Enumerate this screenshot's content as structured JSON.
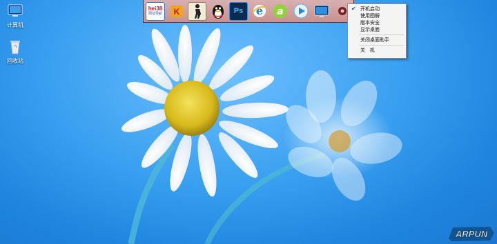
{
  "desktop": {
    "icons": [
      {
        "label": "计算机",
        "icon": "computer-icon"
      },
      {
        "label": "回收站",
        "icon": "recycle-bin-icon"
      }
    ]
  },
  "toolbar": {
    "apps": [
      {
        "name": "hei38-nav",
        "text_top": "hei38",
        "text_bottom": "网址导航"
      },
      {
        "name": "kugou",
        "icon": "kugou-icon"
      },
      {
        "name": "cs-game",
        "icon": "counter-strike-icon"
      },
      {
        "name": "qq",
        "icon": "qq-penguin-icon"
      },
      {
        "name": "photoshop",
        "text": "Ps"
      },
      {
        "name": "ie-browser",
        "icon": "ie-icon"
      },
      {
        "name": "aiqiyi",
        "icon": "green-a-icon"
      },
      {
        "name": "media-player",
        "icon": "play-icon"
      },
      {
        "name": "show-desktop",
        "icon": "monitor-icon"
      }
    ]
  },
  "context_menu": {
    "items": [
      {
        "label": "开机启动",
        "checked": true
      },
      {
        "label": "使用图解",
        "checked": false
      },
      {
        "label": "版本安全",
        "checked": false
      },
      {
        "label": "显示桌面",
        "checked": false
      },
      {
        "label": "关闭桌面助手",
        "checked": false
      },
      {
        "label": "关　机",
        "checked": false
      }
    ]
  },
  "watermark": {
    "text": "ARPUN"
  },
  "colors": {
    "wallpaper": "#3aa0f0",
    "toolbar": "#c99090",
    "menu_bg": "#f4f4f4"
  }
}
